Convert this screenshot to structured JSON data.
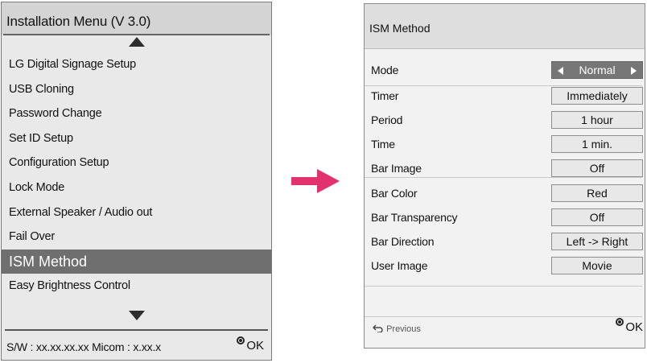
{
  "installation_menu": {
    "title": "Installation Menu (V 3.0)",
    "items": [
      {
        "label": "LG Digital Signage Setup"
      },
      {
        "label": "USB Cloning"
      },
      {
        "label": "Password Change"
      },
      {
        "label": "Set ID Setup"
      },
      {
        "label": "Configuration Setup"
      },
      {
        "label": "Lock Mode"
      },
      {
        "label": "External Speaker / Audio out"
      },
      {
        "label": "Fail Over"
      },
      {
        "label": "ISM Method"
      },
      {
        "label": "Easy Brightness Control"
      }
    ],
    "selected_item": "ISM Method",
    "footer": {
      "sw_info": "S/W : xx.xx.xx.xx Micom : x.xx.x",
      "ok_label": "OK"
    }
  },
  "ism_panel": {
    "title": "ISM Method",
    "settings": [
      {
        "label": "Mode",
        "value": "Normal"
      },
      {
        "label": "Timer",
        "value": "Immediately"
      },
      {
        "label": "Period",
        "value": "1 hour"
      },
      {
        "label": "Time",
        "value": "1 min."
      },
      {
        "label": "Bar Image",
        "value": "Off"
      },
      {
        "label": "Bar Color",
        "value": "Red"
      },
      {
        "label": "Bar Transparency",
        "value": "Off"
      },
      {
        "label": "Bar Direction",
        "value": "Left -> Right"
      },
      {
        "label": "User Image",
        "value": "Movie"
      }
    ],
    "footer": {
      "previous_label": "Previous",
      "ok_label": "OK"
    }
  },
  "icons": {
    "scroll_up": "triangle-up-icon",
    "scroll_down": "triangle-down-icon",
    "ok_button": "ok-circle-icon",
    "previous": "return-arrow-icon",
    "transition": "right-arrow-icon"
  },
  "colors": {
    "selected_bg": "#6f6f6f",
    "arrow_pink": "#e2326e",
    "panel_bg": "#e9e9e9"
  }
}
